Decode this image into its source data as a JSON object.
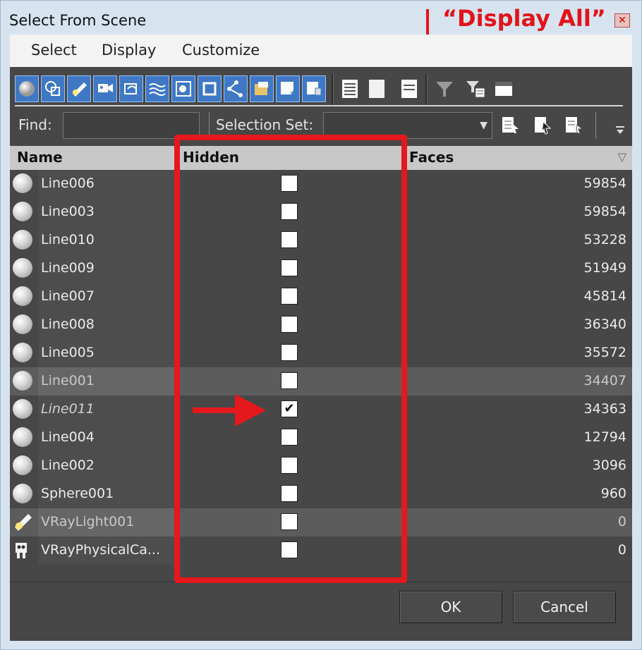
{
  "window": {
    "title": "Select From Scene",
    "close_glyph": "✕"
  },
  "annotation": {
    "display_all": "“Display All”",
    "color": "#e2141a"
  },
  "menu": {
    "items": [
      "Select",
      "Display",
      "Customize"
    ]
  },
  "find": {
    "label": "Find:",
    "value": ""
  },
  "selection_set": {
    "label": "Selection Set:",
    "value": ""
  },
  "columns": {
    "name": "Name",
    "hidden": "Hidden",
    "faces": "Faces"
  },
  "rows": [
    {
      "icon": "geometry-sphere-icon",
      "name": "Line006",
      "hidden": false,
      "faces": "59854",
      "selected": false
    },
    {
      "icon": "geometry-sphere-icon",
      "name": "Line003",
      "hidden": false,
      "faces": "59854",
      "selected": false
    },
    {
      "icon": "geometry-sphere-icon",
      "name": "Line010",
      "hidden": false,
      "faces": "53228",
      "selected": false
    },
    {
      "icon": "geometry-sphere-icon",
      "name": "Line009",
      "hidden": false,
      "faces": "51949",
      "selected": false
    },
    {
      "icon": "geometry-sphere-icon",
      "name": "Line007",
      "hidden": false,
      "faces": "45814",
      "selected": false
    },
    {
      "icon": "geometry-sphere-icon",
      "name": "Line008",
      "hidden": false,
      "faces": "36340",
      "selected": false
    },
    {
      "icon": "geometry-sphere-icon",
      "name": "Line005",
      "hidden": false,
      "faces": "35572",
      "selected": false
    },
    {
      "icon": "geometry-sphere-icon",
      "name": "Line001",
      "hidden": false,
      "faces": "34407",
      "selected": true
    },
    {
      "icon": "geometry-sphere-icon",
      "name": "Line011",
      "hidden": true,
      "faces": "34363",
      "selected": false,
      "italic": true
    },
    {
      "icon": "geometry-sphere-icon",
      "name": "Line004",
      "hidden": false,
      "faces": "12794",
      "selected": false
    },
    {
      "icon": "geometry-sphere-icon",
      "name": "Line002",
      "hidden": false,
      "faces": "3096",
      "selected": false
    },
    {
      "icon": "geometry-sphere-icon",
      "name": "Sphere001",
      "hidden": false,
      "faces": "960",
      "selected": false
    },
    {
      "icon": "light-icon",
      "name": "VRayLight001",
      "hidden": false,
      "faces": "0",
      "selected": true
    },
    {
      "icon": "camera-icon",
      "name": "VRayPhysicalCa...",
      "hidden": false,
      "faces": "0",
      "selected": false
    }
  ],
  "buttons": {
    "ok": "OK",
    "cancel": "Cancel"
  }
}
